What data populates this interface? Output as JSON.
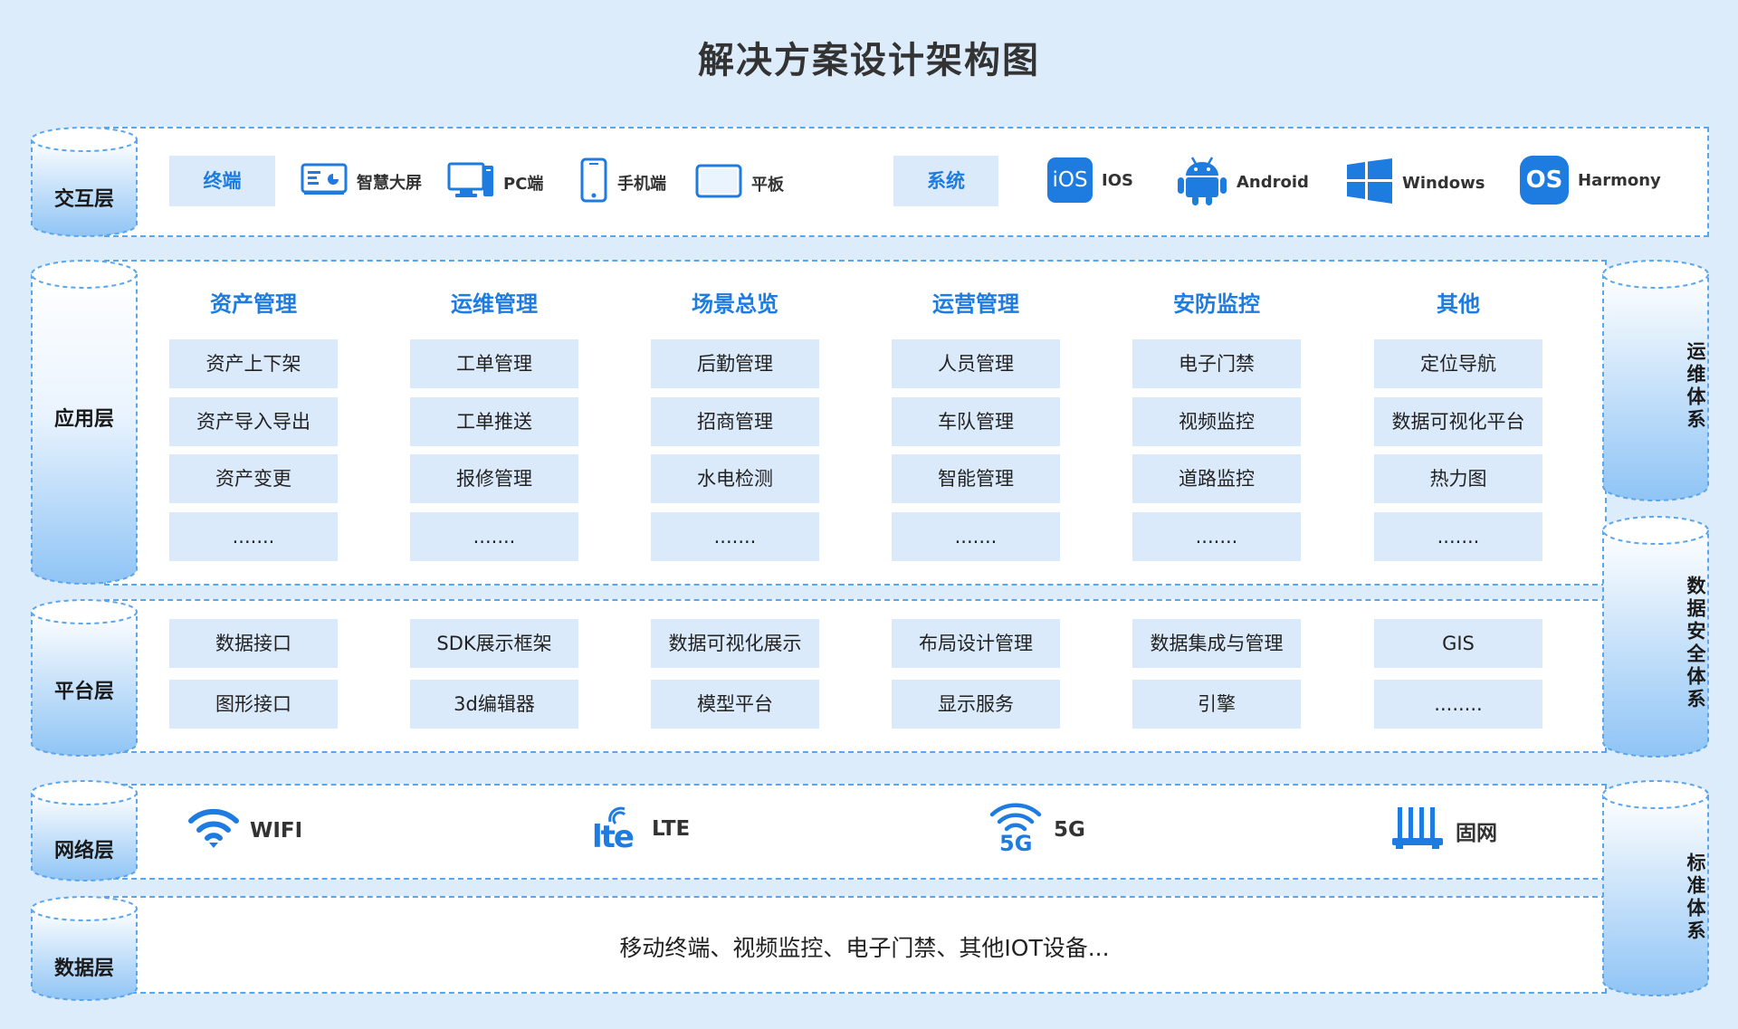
{
  "title": "解决方案设计架构图",
  "colors": {
    "accent": "#1e7be0",
    "tag_bg": "#dbeafb",
    "border": "#5aa6ec",
    "background": "#dcecfb"
  },
  "layers": {
    "interaction": "交互层",
    "application": "应用层",
    "platform": "平台层",
    "network": "网络层",
    "data": "数据层"
  },
  "side_systems": {
    "ops": "运维体系",
    "security": "数据安全体系",
    "standard": "标准体系"
  },
  "interaction": {
    "terminal_tag": "终端",
    "terminals": [
      {
        "label": "智慧大屏",
        "icon": "big-screen-icon"
      },
      {
        "label": "PC端",
        "icon": "pc-icon"
      },
      {
        "label": "手机端",
        "icon": "phone-icon"
      },
      {
        "label": "平板",
        "icon": "tablet-icon"
      }
    ],
    "system_tag": "系统",
    "systems": [
      {
        "label": "IOS",
        "icon": "ios-icon",
        "badge": "iOS"
      },
      {
        "label": "Android",
        "icon": "android-icon"
      },
      {
        "label": "Windows",
        "icon": "windows-icon"
      },
      {
        "label": "Harmony",
        "icon": "harmony-os-icon",
        "badge": "OS"
      }
    ]
  },
  "application": {
    "columns": [
      {
        "title": "资产管理",
        "items": [
          "资产上下架",
          "资产导入导出",
          "资产变更",
          "......."
        ]
      },
      {
        "title": "运维管理",
        "items": [
          "工单管理",
          "工单推送",
          "报修管理",
          "......."
        ]
      },
      {
        "title": "场景总览",
        "items": [
          "后勤管理",
          "招商管理",
          "水电检测",
          "......."
        ]
      },
      {
        "title": "运营管理",
        "items": [
          "人员管理",
          "车队管理",
          "智能管理",
          "......."
        ]
      },
      {
        "title": "安防监控",
        "items": [
          "电子门禁",
          "视频监控",
          "道路监控",
          "......."
        ]
      },
      {
        "title": "其他",
        "items": [
          "定位导航",
          "数据可视化平台",
          "热力图",
          "......."
        ]
      }
    ]
  },
  "platform": {
    "row1": [
      "数据接口",
      "SDK展示框架",
      "数据可视化展示",
      "布局设计管理",
      "数据集成与管理",
      "GIS"
    ],
    "row2": [
      "图形接口",
      "3d编辑器",
      "模型平台",
      "显示服务",
      "引擎",
      "........"
    ]
  },
  "network": {
    "items": [
      {
        "label": "WIFI",
        "icon": "wifi-icon"
      },
      {
        "label": "LTE",
        "icon": "lte-icon",
        "badge": "lte"
      },
      {
        "label": "5G",
        "icon": "5g-icon",
        "badge": "5G"
      },
      {
        "label": "固网",
        "icon": "router-icon"
      }
    ]
  },
  "data_layer": {
    "text": "移动终端、视频监控、电子门禁、其他IOT设备..."
  }
}
